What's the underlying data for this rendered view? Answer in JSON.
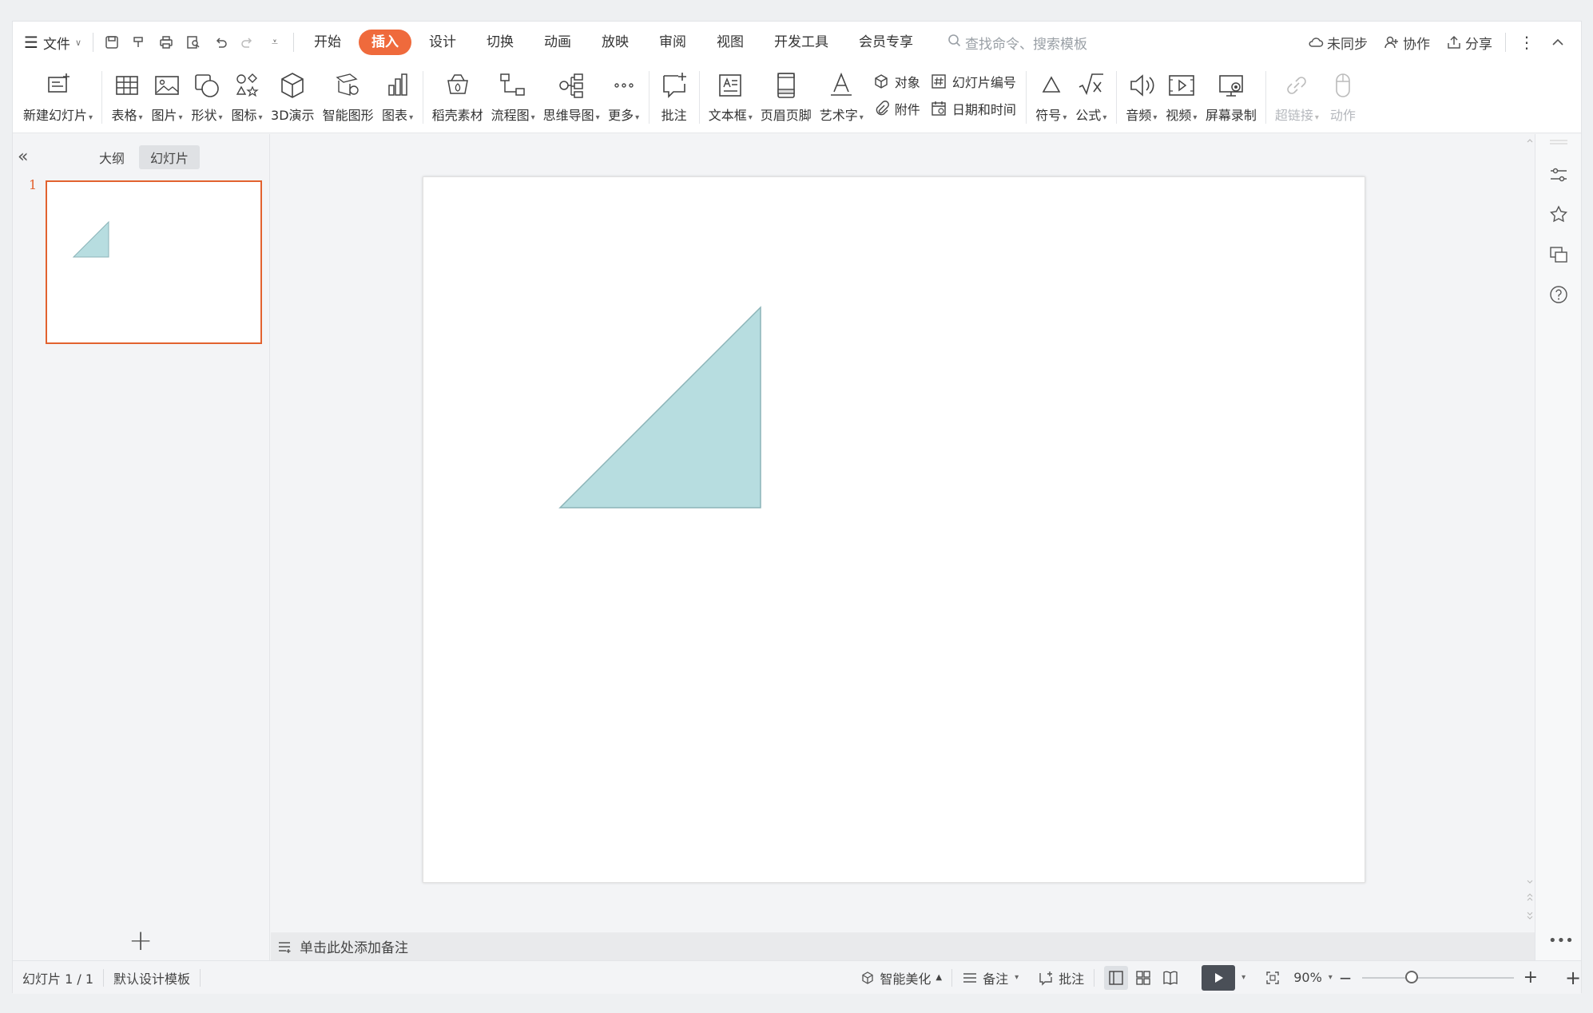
{
  "menu": {
    "file_label": "文件"
  },
  "tabs": [
    {
      "label": "开始",
      "active": false
    },
    {
      "label": "插入",
      "active": true
    },
    {
      "label": "设计",
      "active": false
    },
    {
      "label": "切换",
      "active": false
    },
    {
      "label": "动画",
      "active": false
    },
    {
      "label": "放映",
      "active": false
    },
    {
      "label": "审阅",
      "active": false
    },
    {
      "label": "视图",
      "active": false
    },
    {
      "label": "开发工具",
      "active": false
    },
    {
      "label": "会员专享",
      "active": false
    }
  ],
  "search": {
    "placeholder": "查找命令、搜索模板"
  },
  "header_actions": {
    "sync": "未同步",
    "collab": "协作",
    "share": "分享"
  },
  "ribbon": {
    "new_slide": "新建幻灯片",
    "table": "表格",
    "picture": "图片",
    "shape": "形状",
    "icon": "图标",
    "demo3d": "3D演示",
    "smart_graphic": "智能图形",
    "chart": "图表",
    "material": "稻壳素材",
    "flowchart": "流程图",
    "mindmap": "思维导图",
    "more": "更多",
    "comment": "批注",
    "textbox": "文本框",
    "header_footer": "页眉页脚",
    "wordart": "艺术字",
    "object": "对象",
    "attachment": "附件",
    "slide_number": "幻灯片编号",
    "datetime": "日期和时间",
    "symbol": "符号",
    "formula": "公式",
    "audio": "音频",
    "video": "视频",
    "screen_record": "屏幕录制",
    "hyperlink": "超链接",
    "action": "动作"
  },
  "left_panel": {
    "tab_outline": "大纲",
    "tab_slides": "幻灯片",
    "slide_number": "1",
    "add_label": "+"
  },
  "notes": {
    "placeholder": "单击此处添加备注"
  },
  "status_bar": {
    "slide_info": "幻灯片 1 / 1",
    "template": "默认设计模板",
    "beautify": "智能美化",
    "notes": "备注",
    "comment": "批注",
    "zoom": "90%",
    "zoom_level": 0.33
  },
  "colors": {
    "accent": "#ef6a3c",
    "triangle_fill": "#b7dde0",
    "triangle_stroke": "#8cb4b8",
    "thumb_border": "#e2622f"
  }
}
